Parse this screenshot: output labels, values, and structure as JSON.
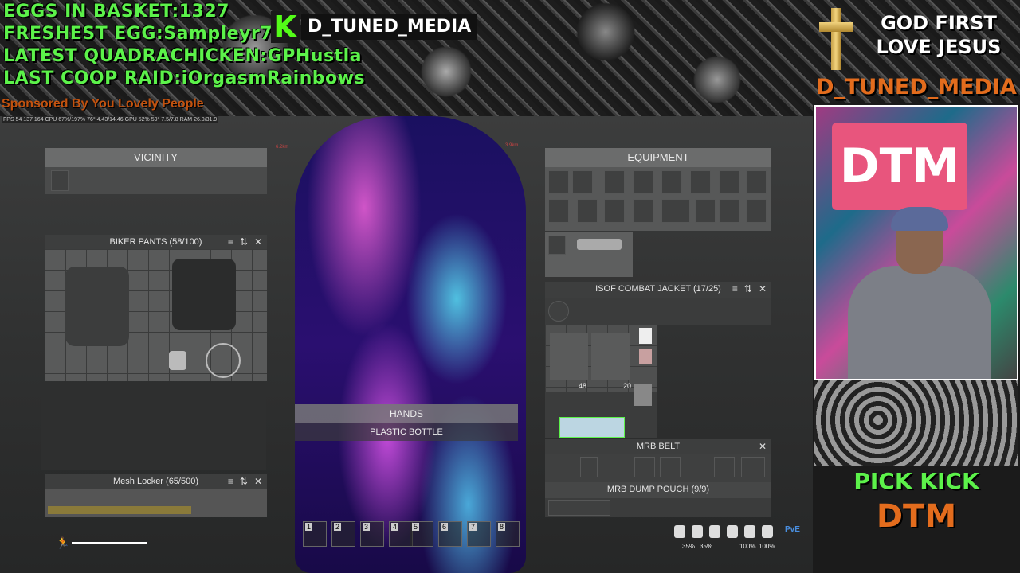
{
  "overlay": {
    "eggs_basket": "EGGS IN BASKET:1327",
    "freshest_egg": "FRESHEST EGG:Sampleyr762",
    "latest_quadrachicken": "LATEST QUADRACHICKEN:GPHustla",
    "last_coop_raid": "LAST COOP RAID:iOrgasmRainbows",
    "sponsor": "Sponsored By You Lovely People",
    "perf_line": "FPS 54  137 164  CPU 67%/197%  76°  4.43/14.46  GPU 52%  59°  7.5/7.8  RAM 26.0/31.9",
    "kick_logo": "K",
    "channel_name": "D_TUNED_MEDIA",
    "god_first": "GOD FIRST",
    "love_jesus": "LOVE JESUS",
    "right_channel": "D_TUNED_MEDIA",
    "cam_sign": "DTM",
    "pick_kick": "PICK KICK",
    "dtm": "DTM"
  },
  "hud": {
    "marker_left": "6.2km",
    "marker_right": "3.9km"
  },
  "vicinity": {
    "title": "VICINITY"
  },
  "biker_pants": {
    "title": "BIKER PANTS (58/100)"
  },
  "mesh_locker": {
    "title": "Mesh Locker (65/500)"
  },
  "equipment": {
    "title": "EQUIPMENT"
  },
  "isof_jacket": {
    "title": "ISOF COMBAT JACKET (17/25)",
    "count_a": "48",
    "count_b": "20"
  },
  "mrb_belt": {
    "title": "MRB BELT"
  },
  "mrb_pouch": {
    "title": "MRB DUMP POUCH (9/9)"
  },
  "hands": {
    "title": "HANDS",
    "item": "PLASTIC BOTTLE"
  },
  "quickbar": [
    "1",
    "2",
    "3",
    "4",
    "5",
    "6",
    "7",
    "8"
  ],
  "status": {
    "p1": "35%",
    "p2": "35%",
    "p3": "100%",
    "p4": "100%",
    "mode": "PvE"
  },
  "icons": {
    "stack": "stack-icon",
    "swap": "swap-icon",
    "close": "close-icon",
    "run": "running-person-icon"
  },
  "colors": {
    "overlay_green": "#5cf24a",
    "overlay_orange": "#e36c1d",
    "panel_header": "#6b6c6c",
    "kick_green": "#53fc18"
  }
}
